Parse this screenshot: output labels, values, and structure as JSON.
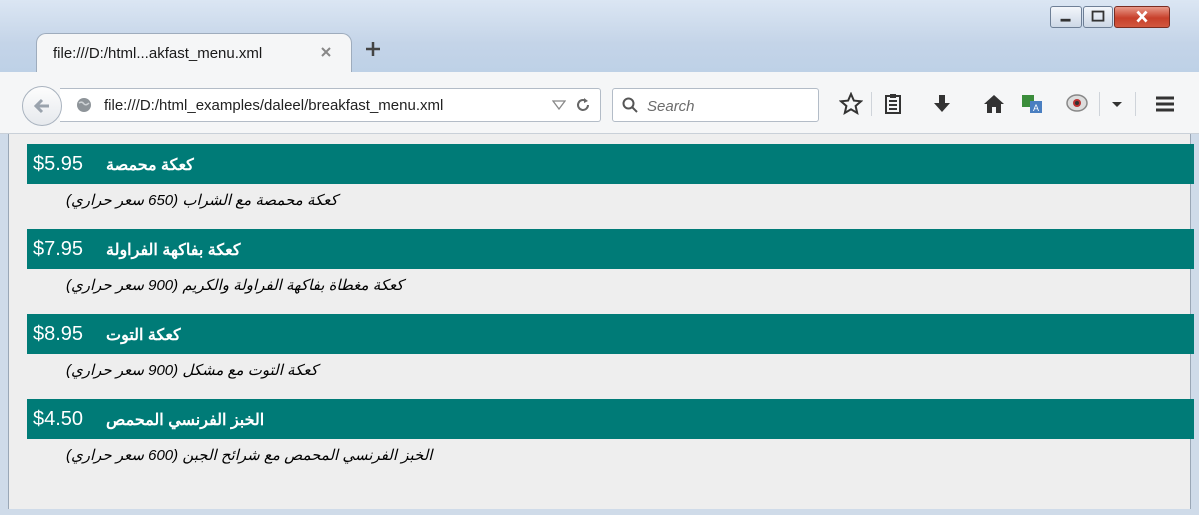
{
  "tab": {
    "title": "file:///D:/html...akfast_menu.xml"
  },
  "nav": {
    "url": "file:///D:/html_examples/daleel/breakfast_menu.xml",
    "search_placeholder": "Search"
  },
  "menu": [
    {
      "name": "كعكة محمصة",
      "price": "$5.95",
      "description": "(كعكة محمصة مع الشراب (650 سعر حراري"
    },
    {
      "name": "كعكة بفاكهة الفراولة",
      "price": "$7.95",
      "description": "(كعكة مغطاة بفاكهة الفراولة والكريم (900 سعر حراري"
    },
    {
      "name": "كعكة التوت",
      "price": "$8.95",
      "description": "(كعكة التوت مع مشكل (900 سعر حراري"
    },
    {
      "name": "الخبز الفرنسي المحمص",
      "price": "$4.50",
      "description": "(الخبز الفرنسي المحمص مع شرائح الجبن (600 سعر حراري"
    }
  ],
  "colors": {
    "header_bg": "#007b77",
    "content_bg": "#eeeeee"
  },
  "icons": [
    "minimize-icon",
    "maximize-icon",
    "close-icon",
    "tab-close-icon",
    "plus-icon",
    "back-arrow-icon",
    "globe-icon",
    "dropdown-icon",
    "reload-icon",
    "search-icon",
    "star-icon",
    "reading-list-icon",
    "download-icon",
    "home-icon",
    "translate-icon",
    "chat-icon",
    "menu-icon"
  ]
}
